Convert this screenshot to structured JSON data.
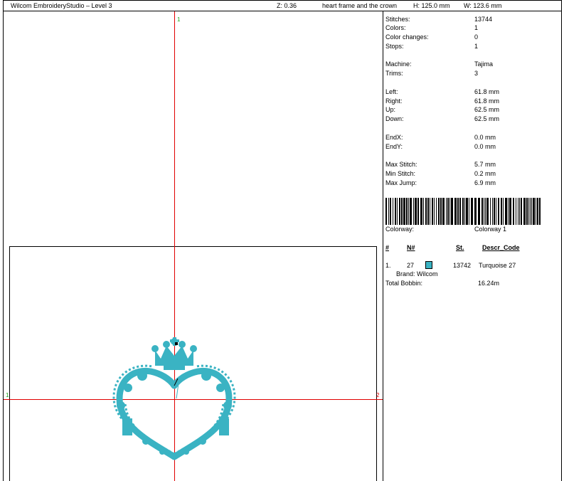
{
  "header": {
    "app_title": "Wilcom EmbroideryStudio – Level 3",
    "zoom": "Z: 0.36",
    "design_name": "heart frame and the crown",
    "height": "H: 125.0 mm",
    "width": "W: 123.6 mm"
  },
  "canvas": {
    "axis_top": "1",
    "axis_left": "1",
    "axis_right": "2"
  },
  "stats": [
    {
      "label": "Stitches:",
      "value": "13744"
    },
    {
      "label": "Colors:",
      "value": "1"
    },
    {
      "label": "Color changes:",
      "value": "0"
    },
    {
      "label": "Stops:",
      "value": "1"
    },
    {
      "label": "Machine:",
      "value": "Tajima"
    },
    {
      "label": "Trims:",
      "value": "3"
    },
    {
      "label": "Left:",
      "value": "61.8 mm"
    },
    {
      "label": "Right:",
      "value": "61.8 mm"
    },
    {
      "label": "Up:",
      "value": "62.5 mm"
    },
    {
      "label": "Down:",
      "value": "62.5 mm"
    },
    {
      "label": "EndX:",
      "value": "0.0 mm"
    },
    {
      "label": "EndY:",
      "value": "0.0 mm"
    },
    {
      "label": "Max Stitch:",
      "value": "5.7 mm"
    },
    {
      "label": "Min Stitch:",
      "value": "0.2 mm"
    },
    {
      "label": "Max Jump:",
      "value": "6.9 mm"
    }
  ],
  "colorway": {
    "label": "Colorway:",
    "value": "Colorway 1"
  },
  "table": {
    "headers": [
      "#",
      "N#",
      "St.",
      "Descr_Code"
    ],
    "row": {
      "index": "1.",
      "n": "27",
      "stitches": "13742",
      "descr": "Turquoise 27",
      "swatch_color": "#3ab3c3",
      "brand": "Brand: Wilcom"
    }
  },
  "bobbin": {
    "label": "Total Bobbin:",
    "value": "16.24m"
  },
  "colors": {
    "thread": "#3ab3c3",
    "guides": "#e00000",
    "axis_num": "#1aa51a"
  }
}
